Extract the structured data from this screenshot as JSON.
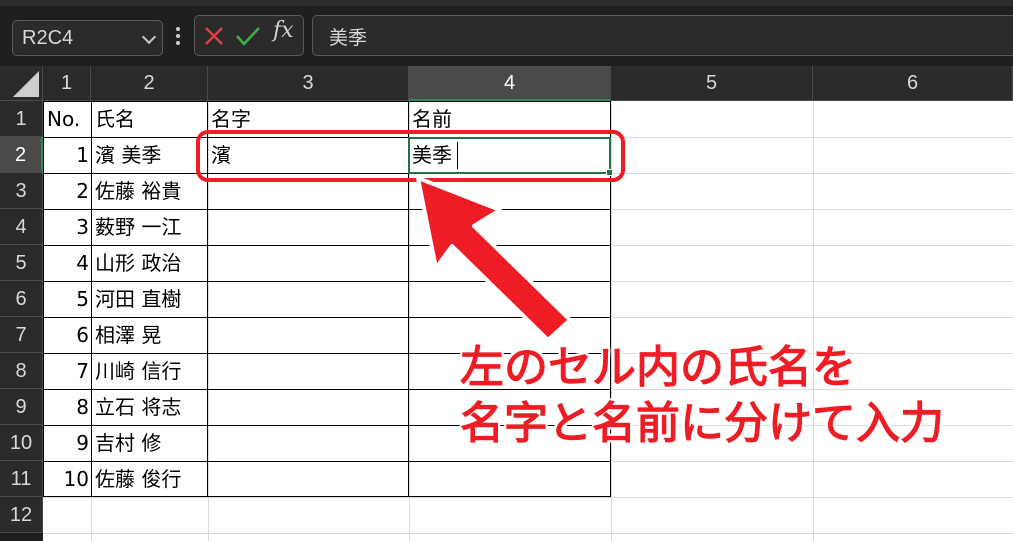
{
  "formula_bar": {
    "name_box": "R2C4",
    "fx_label": "fx",
    "formula": "美季"
  },
  "sheet": {
    "columns": [
      "1",
      "2",
      "3",
      "4",
      "5",
      "6"
    ],
    "rows": [
      "1",
      "2",
      "3",
      "4",
      "5",
      "6",
      "7",
      "8",
      "9",
      "10",
      "11",
      "12"
    ],
    "header_row": [
      "No.",
      "氏名",
      "名字",
      "名前"
    ],
    "records": [
      {
        "no": "1",
        "name": "濱 美季",
        "family": "濱",
        "given": "美季"
      },
      {
        "no": "2",
        "name": "佐藤 裕貴",
        "family": "",
        "given": ""
      },
      {
        "no": "3",
        "name": "薮野 一江",
        "family": "",
        "given": ""
      },
      {
        "no": "4",
        "name": "山形 政治",
        "family": "",
        "given": ""
      },
      {
        "no": "5",
        "name": "河田 直樹",
        "family": "",
        "given": ""
      },
      {
        "no": "6",
        "name": "相澤 晃",
        "family": "",
        "given": ""
      },
      {
        "no": "7",
        "name": "川崎 信行",
        "family": "",
        "given": ""
      },
      {
        "no": "8",
        "name": "立石 将志",
        "family": "",
        "given": ""
      },
      {
        "no": "9",
        "name": "吉村 修",
        "family": "",
        "given": ""
      },
      {
        "no": "10",
        "name": "佐藤 俊行",
        "family": "",
        "given": ""
      }
    ],
    "selected_column": "4",
    "selected_row": "2"
  },
  "annotation": {
    "line1": "左のセル内の氏名を",
    "line2": "名字と名前に分けて入力",
    "color": "#ee1c24"
  },
  "colors": {
    "excel_green": "#217346",
    "header_bg": "#2b2b2b",
    "cancel_red": "#e04040",
    "enter_green": "#3fae49"
  }
}
